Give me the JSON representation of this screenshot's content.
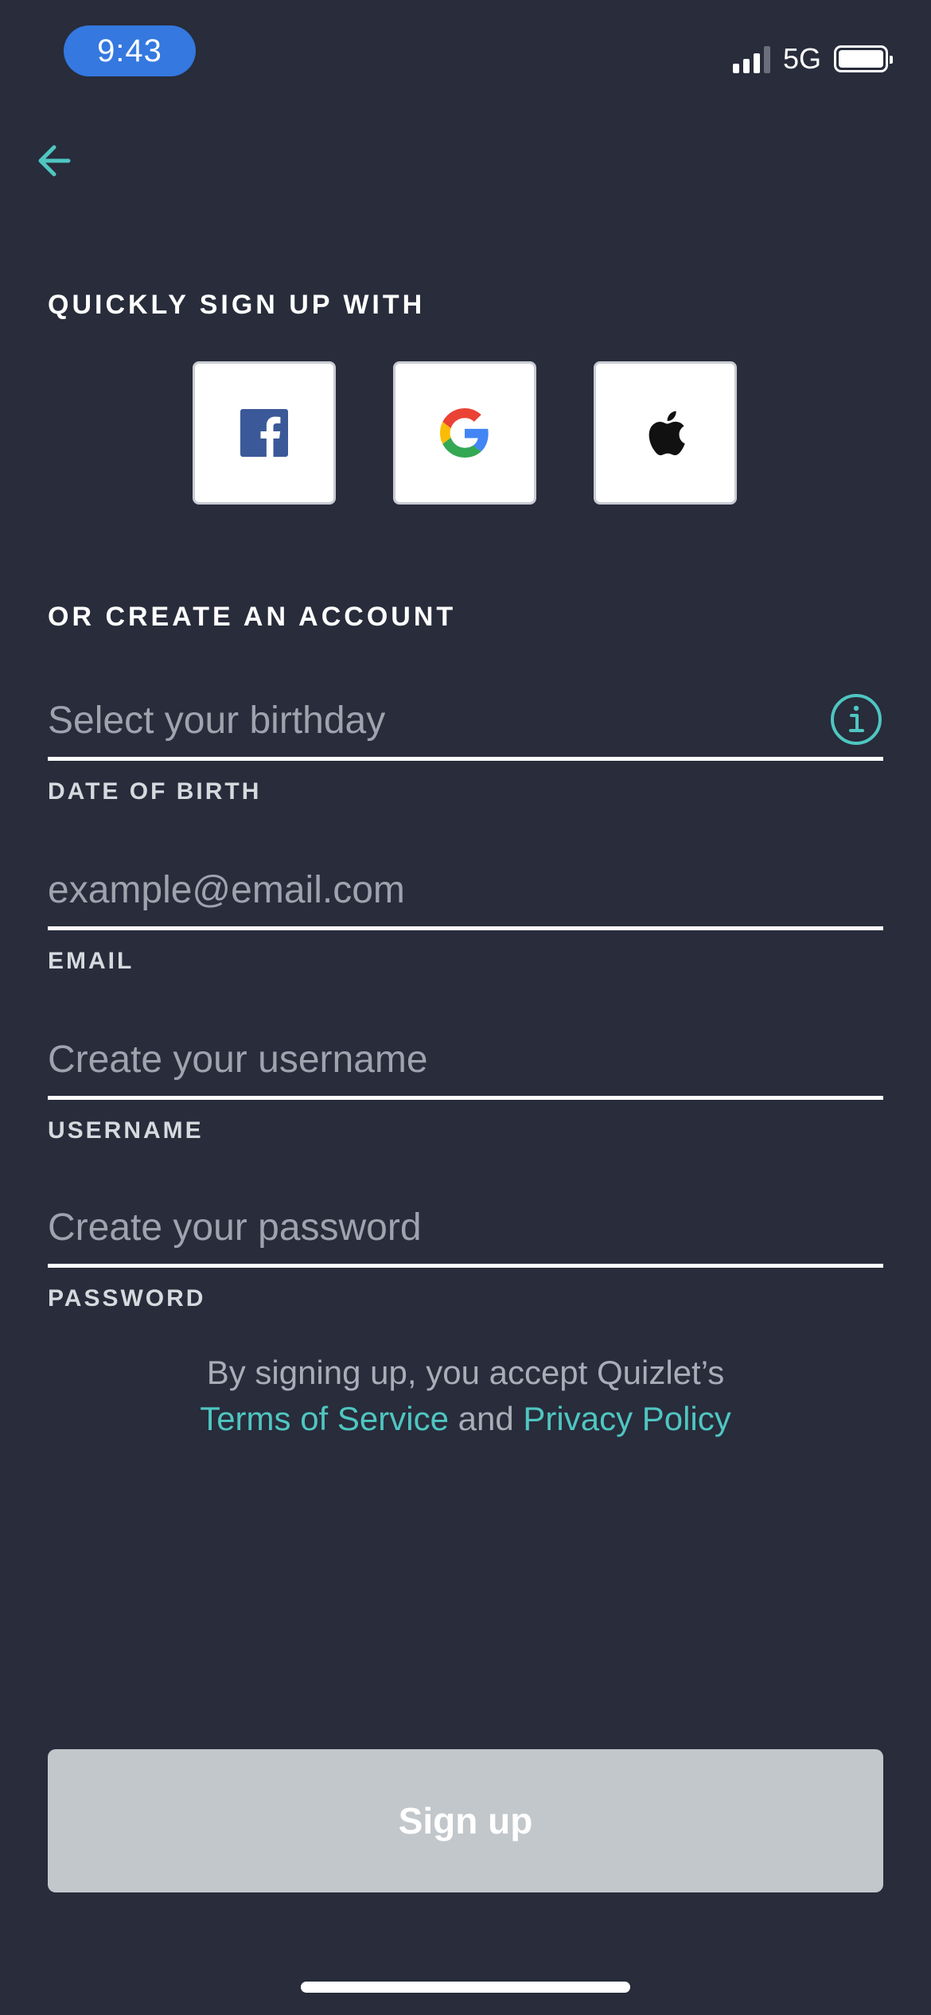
{
  "status_bar": {
    "time": "9:43",
    "network": "5G",
    "signal_bars_filled": 3,
    "signal_bars_total": 4,
    "battery_level": 0.9
  },
  "nav": {
    "back_icon": "arrow-left-icon"
  },
  "social": {
    "heading": "QUICKLY SIGN UP WITH",
    "buttons": [
      {
        "name": "facebook",
        "icon": "facebook-icon"
      },
      {
        "name": "google",
        "icon": "google-icon"
      },
      {
        "name": "apple",
        "icon": "apple-icon"
      }
    ]
  },
  "form": {
    "heading": "OR CREATE AN ACCOUNT",
    "birthday": {
      "placeholder": "Select your birthday",
      "label": "DATE OF BIRTH",
      "icon": "info-icon"
    },
    "email": {
      "placeholder": "example@email.com",
      "label": "EMAIL"
    },
    "username": {
      "placeholder": "Create your username",
      "label": "USERNAME"
    },
    "password": {
      "placeholder": "Create your password",
      "label": "PASSWORD"
    }
  },
  "terms": {
    "line1": "By signing up, you accept Quizlet’s",
    "terms_link": "Terms of Service",
    "conjunction": "and",
    "privacy_link": "Privacy Policy"
  },
  "signup_button": {
    "label": "Sign up"
  },
  "colors": {
    "background": "#282c3b",
    "accent": "#4fc6c1",
    "time_pill": "#3478e0",
    "disabled_button": "#c2c7cb",
    "facebook": "#3b5998"
  }
}
